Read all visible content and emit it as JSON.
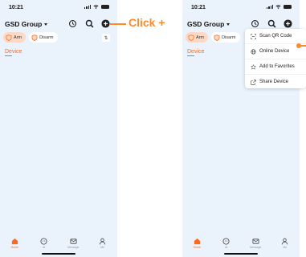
{
  "status": {
    "time": "10:21"
  },
  "header": {
    "title": "GSD Group"
  },
  "chips": {
    "arm": "Arm",
    "disarm": "Disarm"
  },
  "section": {
    "label": "Device"
  },
  "tabs": [
    {
      "label": "Home",
      "icon": "home-icon"
    },
    {
      "label": "AI",
      "icon": "ai-icon"
    },
    {
      "label": "Message",
      "icon": "message-icon"
    },
    {
      "label": "Me",
      "icon": "me-icon"
    }
  ],
  "callout": {
    "text": "Click +"
  },
  "menu": {
    "items": [
      {
        "label": "Scan QR Code",
        "icon": "scan-icon"
      },
      {
        "label": "Online Device",
        "icon": "globe-icon"
      },
      {
        "label": "Add to Favorites",
        "icon": "star-icon"
      },
      {
        "label": "Share Device",
        "icon": "share-icon"
      }
    ]
  },
  "colors": {
    "accent": "#ff6a1a",
    "callout": "#ff8a2a",
    "background": "#eaf2fb"
  }
}
